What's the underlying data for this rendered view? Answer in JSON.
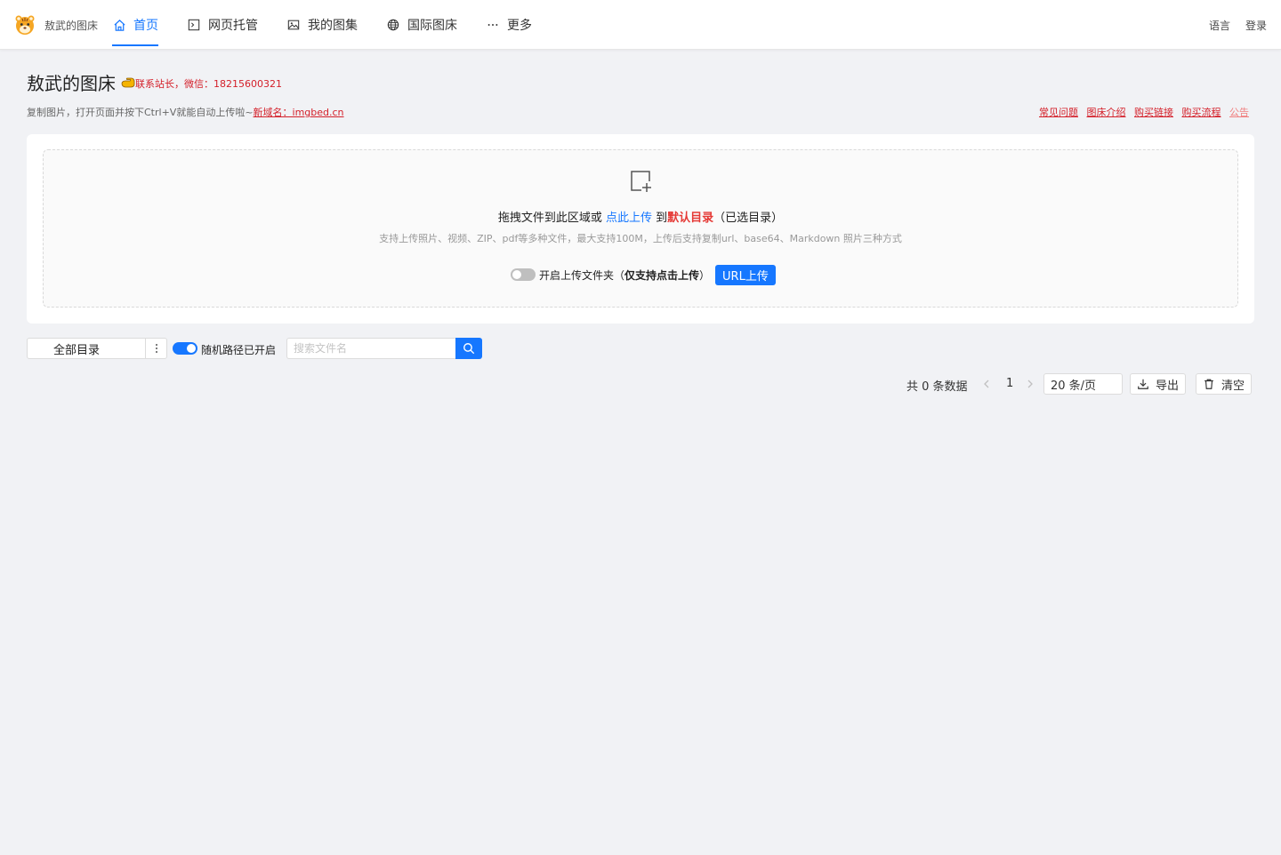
{
  "nav": {
    "brand": "敖武的图床",
    "items": [
      {
        "label": "首页",
        "icon": "home-icon"
      },
      {
        "label": "网页托管",
        "icon": "terminal-icon"
      },
      {
        "label": "我的图集",
        "icon": "image-icon"
      },
      {
        "label": "国际图床",
        "icon": "globe-icon"
      },
      {
        "label": "更多",
        "icon": "ellipsis-icon"
      }
    ],
    "active_index": 0,
    "language": "语言",
    "login": "登录"
  },
  "header": {
    "title": "敖武的图床",
    "contact": "联系站长，微信：18215600321",
    "subtitle_prefix": "复制图片，打开页面并按下Ctrl+V就能自动上传啦~",
    "subtitle_link": "新域名：imgbed.cn",
    "links": [
      "常见问题",
      "图床介绍",
      "购买链接",
      "购买流程",
      "公告"
    ]
  },
  "upload": {
    "drag_text": "拖拽文件到此区域或",
    "click_text": "点此上传",
    "to_text": "到",
    "dir_text": "默认目录",
    "selected_text": "（已选目录）",
    "support_text": "支持上传照片、视频、ZIP、pdf等多种文件，最大支持100M，上传后支持复制url、base64、Markdown 照片三种方式",
    "folder_label_prefix": "开启上传文件夹（",
    "folder_label_bold": "仅支持点击上传",
    "folder_label_suffix": "）",
    "folder_enabled": false,
    "url_button": "URL上传"
  },
  "toolbar": {
    "directory": "全部目录",
    "random_path_label": "随机路径已开启",
    "random_path_enabled": true,
    "search_placeholder": "搜索文件名",
    "search_value": ""
  },
  "pagination": {
    "total": "共 0 条数据",
    "current_page": "1",
    "page_size": "20 条/页",
    "export": "导出",
    "clear": "清空"
  },
  "colors": {
    "accent": "#1677ff",
    "danger": "#d4202a",
    "background": "#f1f2f5"
  }
}
